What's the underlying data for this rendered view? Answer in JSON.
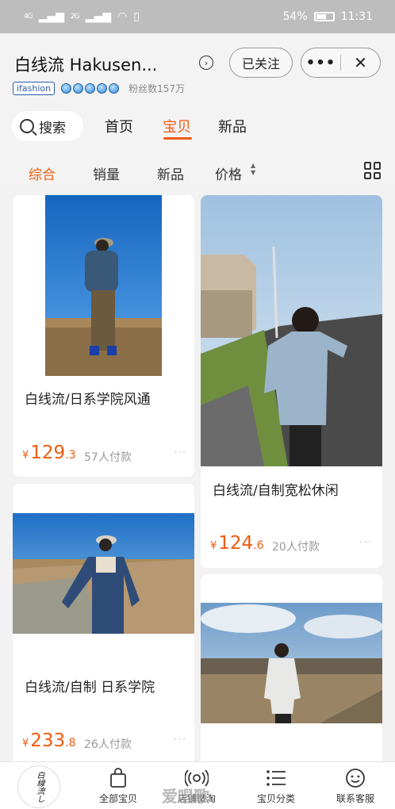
{
  "status_bar": {
    "signal_1": "4G",
    "signal_2": "2G",
    "battery": "54%",
    "time": "11:31"
  },
  "header": {
    "shop_name": "白线流 Hakusen...",
    "follow_button": "已关注",
    "badge": "ifashion",
    "fans": "粉丝数157万"
  },
  "search": {
    "label": "搜索"
  },
  "nav_tabs": [
    {
      "label": "首页"
    },
    {
      "label": "宝贝"
    },
    {
      "label": "新品"
    }
  ],
  "sort_tabs": [
    {
      "label": "综合"
    },
    {
      "label": "销量"
    },
    {
      "label": "新品"
    },
    {
      "label": "价格"
    }
  ],
  "products": [
    {
      "title": "白线流/日系学院风通",
      "price_int": "129",
      "price_dec": ".3",
      "currency": "¥",
      "sold": "57人付款"
    },
    {
      "title": "白线流/自制宽松休闲",
      "price_int": "124",
      "price_dec": ".6",
      "currency": "¥",
      "sold": "20人付款"
    },
    {
      "title": "白线流/自制 日系学院",
      "price_int": "233",
      "price_dec": ".8",
      "currency": "¥",
      "sold": "26人付款"
    }
  ],
  "bottom_nav": {
    "logo_text": "白線流し",
    "items": [
      {
        "label": "全部宝贝"
      },
      {
        "label": "店铺微淘"
      },
      {
        "label": "宝贝分类"
      },
      {
        "label": "联系客服"
      }
    ]
  },
  "watermark": "爱唱歌",
  "colors": {
    "accent": "#f05a0e",
    "status_bar": "#bdbdbd"
  }
}
